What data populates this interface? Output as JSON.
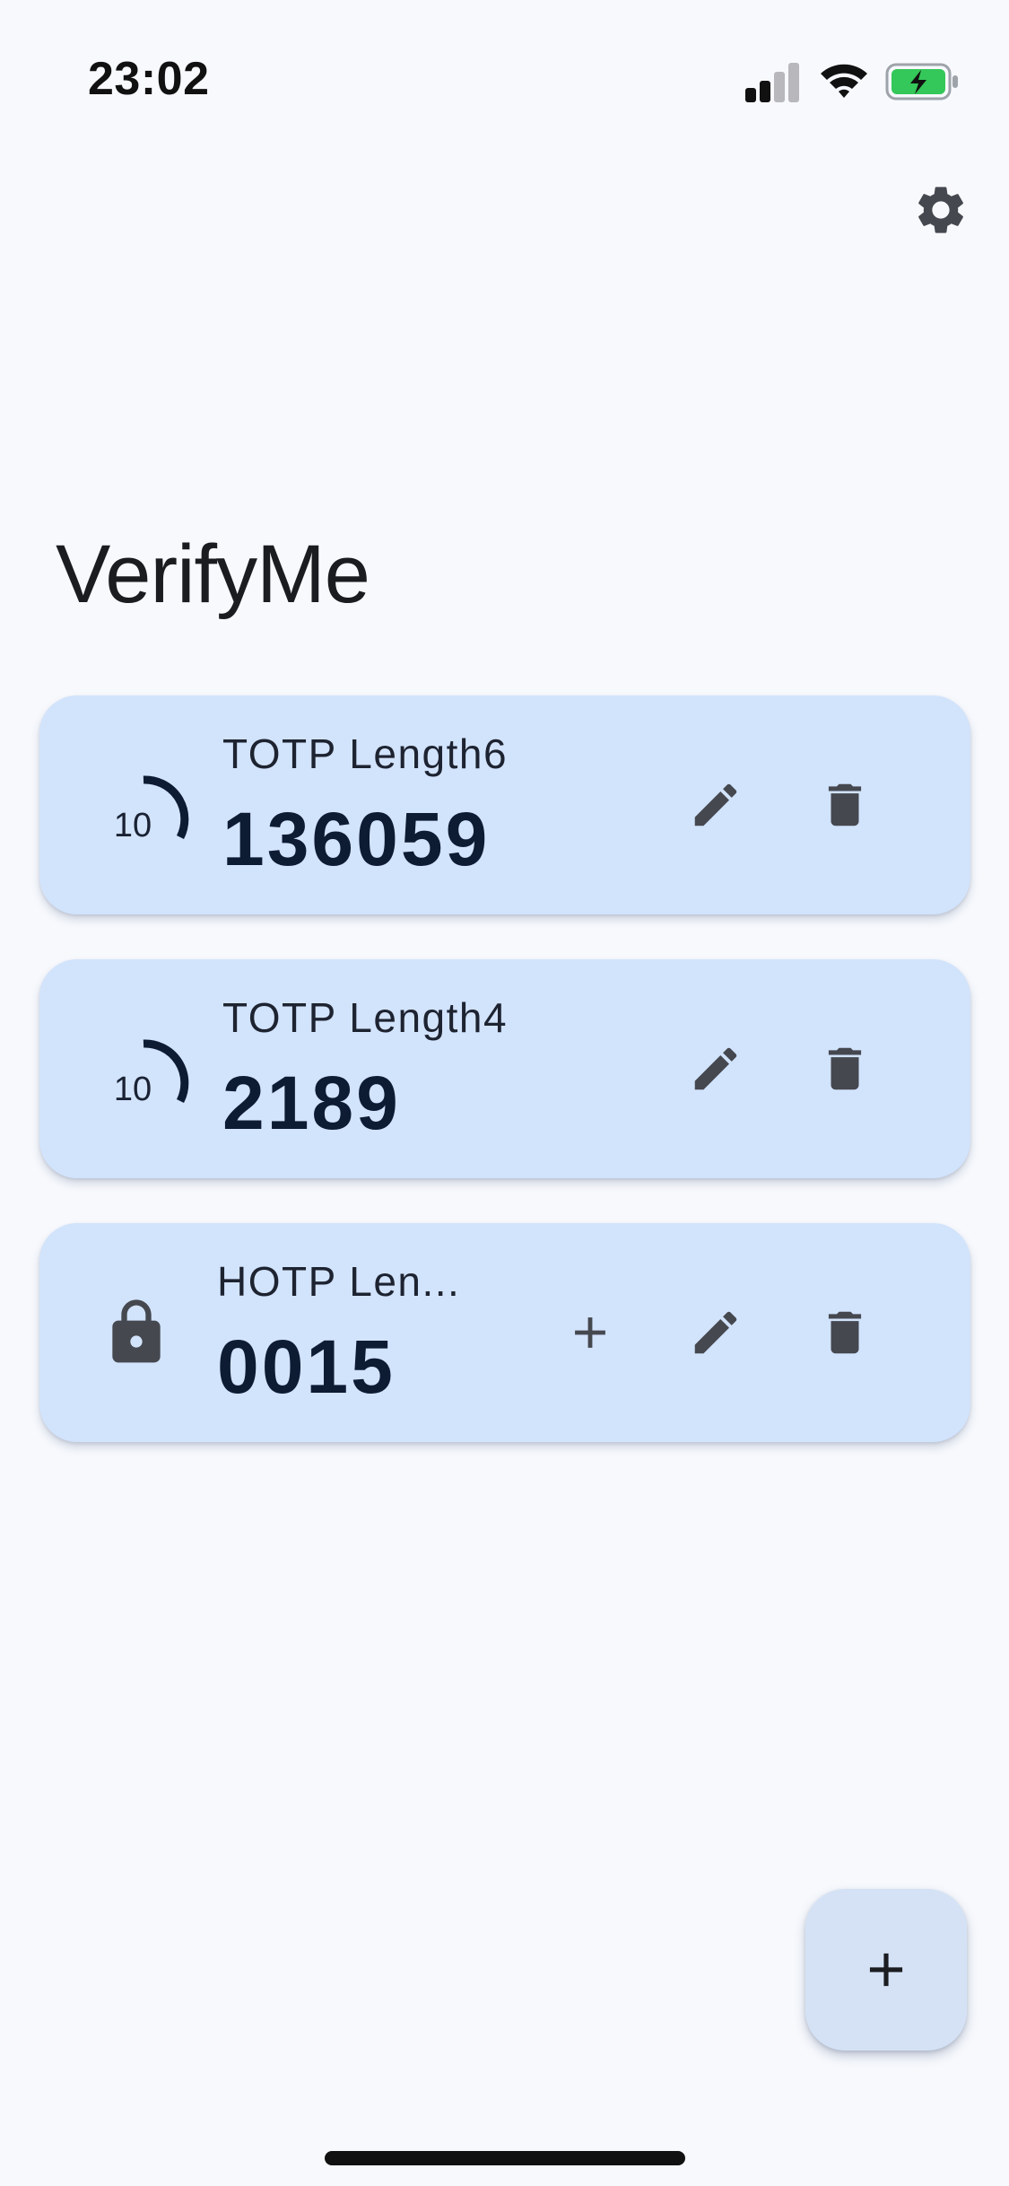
{
  "status_bar": {
    "time": "23:02",
    "signal_icon": "cellular-signal-icon",
    "wifi_icon": "wifi-icon",
    "battery_icon": "battery-charging-icon",
    "battery_color": "#34c759"
  },
  "header": {
    "settings_icon": "gear-icon",
    "title": "VerifyMe"
  },
  "accounts": [
    {
      "name": "TOTP Length6",
      "code": "136059",
      "type": "TOTP",
      "seconds_remaining": "10",
      "edit_icon": "pencil-icon",
      "delete_icon": "trash-icon"
    },
    {
      "name": "TOTP Length4",
      "code": "2189",
      "type": "TOTP",
      "seconds_remaining": "10",
      "edit_icon": "pencil-icon",
      "delete_icon": "trash-icon"
    },
    {
      "name": "HOTP Len...",
      "code": "0015",
      "type": "HOTP",
      "lock_icon": "lock-icon",
      "increment_icon": "plus-icon",
      "edit_icon": "pencil-icon",
      "delete_icon": "trash-icon"
    }
  ],
  "fab": {
    "icon": "plus-icon"
  },
  "colors": {
    "background": "#f7f9fd",
    "card": "#d2e3fc",
    "code_text": "#0d1b33",
    "icon": "#45484f",
    "fab": "#d5e2f6"
  }
}
